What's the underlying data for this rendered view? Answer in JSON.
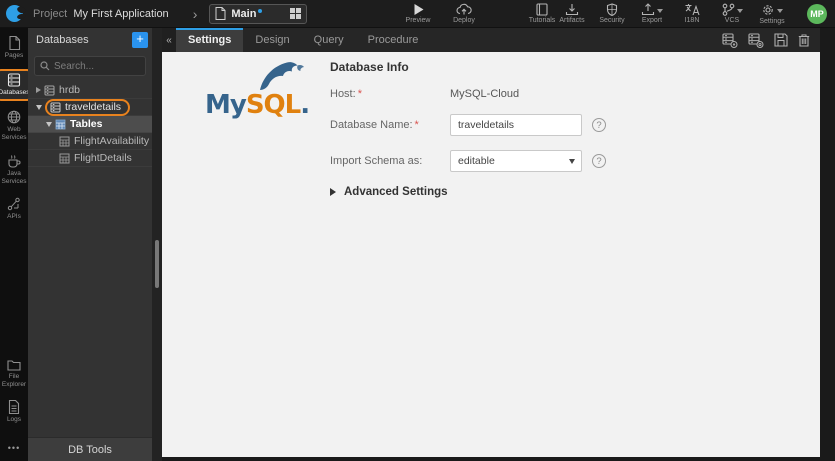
{
  "topbar": {
    "project_prefix": "Project",
    "project_name": "My First Application",
    "page_name": "Main",
    "preview": "Preview",
    "deploy": "Deploy",
    "tutorials": "Tutorials",
    "artifacts": "Artifacts",
    "security": "Security",
    "export": "Export",
    "i18n": "I18N",
    "vcs": "VCS",
    "settings": "Settings",
    "avatar_initials": "MP"
  },
  "rail": {
    "items": [
      {
        "label": "Pages"
      },
      {
        "label": "Databases",
        "active": true
      },
      {
        "label": "Web Services"
      },
      {
        "label": "Java Services"
      },
      {
        "label": "APIs"
      },
      {
        "label": "File Explorer"
      },
      {
        "label": "Logs"
      }
    ],
    "more_icon": "•••"
  },
  "panel": {
    "title": "Databases",
    "add_button": "+",
    "collapse_button": "«",
    "search_placeholder": "Search...",
    "tree": [
      {
        "label": "hrdb",
        "type": "database",
        "expanded": false
      },
      {
        "label": "traveldetails",
        "type": "database",
        "expanded": true,
        "annotated": true
      },
      {
        "label": "Tables",
        "type": "table-folder",
        "expanded": true,
        "selected": true
      },
      {
        "label": "FlightAvailability",
        "type": "table"
      },
      {
        "label": "FlightDetails",
        "type": "table"
      }
    ],
    "footer": "DB Tools"
  },
  "main": {
    "tabs": [
      {
        "label": "Settings",
        "active": true
      },
      {
        "label": "Design"
      },
      {
        "label": "Query"
      },
      {
        "label": "Procedure"
      }
    ],
    "toolbar_icons": [
      "database-update-icon",
      "database-shell-icon",
      "save-icon",
      "delete-icon"
    ],
    "logo": {
      "my": "My",
      "sql": "SQL",
      "dot": "."
    },
    "form": {
      "heading": "Database Info",
      "required_mark": "*",
      "host_label": "Host:",
      "host_value": "MySQL-Cloud",
      "name_label": "Database Name:",
      "name_value": "traveldetails",
      "schema_label": "Import Schema as:",
      "schema_value": "editable",
      "advanced_label": "Advanced Settings",
      "help_icon": "?"
    }
  },
  "colors": {
    "accent_blue": "#2e9fe6",
    "annotation_orange": "#e8821e",
    "mysql_blue": "#36648c",
    "mysql_orange": "#e0810f",
    "avatar_green": "#5cb85c"
  }
}
